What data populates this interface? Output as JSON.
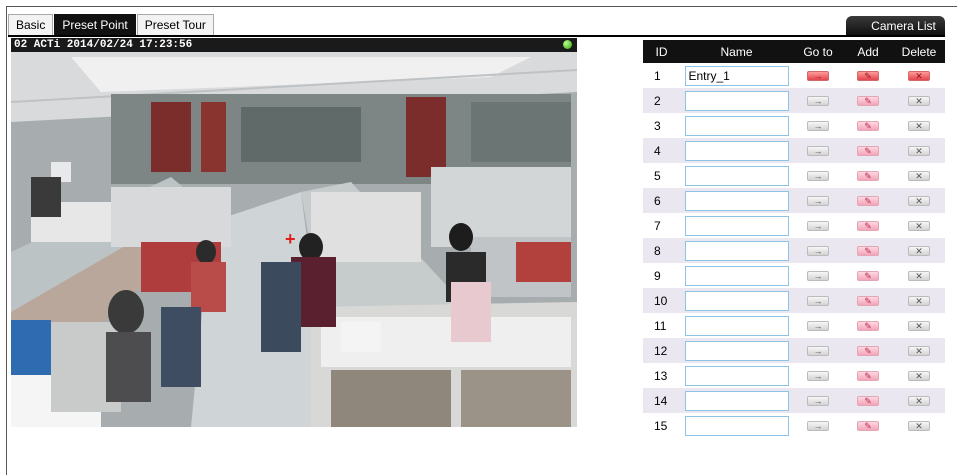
{
  "tabs": [
    {
      "label": "Basic",
      "active": false
    },
    {
      "label": "Preset Point",
      "active": true
    },
    {
      "label": "Preset Tour",
      "active": false
    }
  ],
  "camera_list_label": "Camera List",
  "video": {
    "title": "02 ACTi  2014/02/24 17:23:56",
    "status_color": "#3cb815"
  },
  "table": {
    "headers": {
      "id": "ID",
      "name": "Name",
      "goto": "Go to",
      "add": "Add",
      "delete": "Delete"
    },
    "rows": [
      {
        "id": "1",
        "name": "Entry_1",
        "defined": true
      },
      {
        "id": "2",
        "name": "",
        "defined": false
      },
      {
        "id": "3",
        "name": "",
        "defined": false
      },
      {
        "id": "4",
        "name": "",
        "defined": false
      },
      {
        "id": "5",
        "name": "",
        "defined": false
      },
      {
        "id": "6",
        "name": "",
        "defined": false
      },
      {
        "id": "7",
        "name": "",
        "defined": false
      },
      {
        "id": "8",
        "name": "",
        "defined": false
      },
      {
        "id": "9",
        "name": "",
        "defined": false
      },
      {
        "id": "10",
        "name": "",
        "defined": false
      },
      {
        "id": "11",
        "name": "",
        "defined": false
      },
      {
        "id": "12",
        "name": "",
        "defined": false
      },
      {
        "id": "13",
        "name": "",
        "defined": false
      },
      {
        "id": "14",
        "name": "",
        "defined": false
      },
      {
        "id": "15",
        "name": "",
        "defined": false
      }
    ]
  },
  "icons": {
    "goto": "arrow-right-icon",
    "add": "pencil-icon",
    "delete": "x-icon"
  },
  "colors": {
    "tab_active": "#111111",
    "header_bg": "#111111",
    "row_alt": "#eae7f1",
    "input_border": "#8dc3e5",
    "button_active": "#e3454d",
    "button_add": "#f3a5b9"
  }
}
